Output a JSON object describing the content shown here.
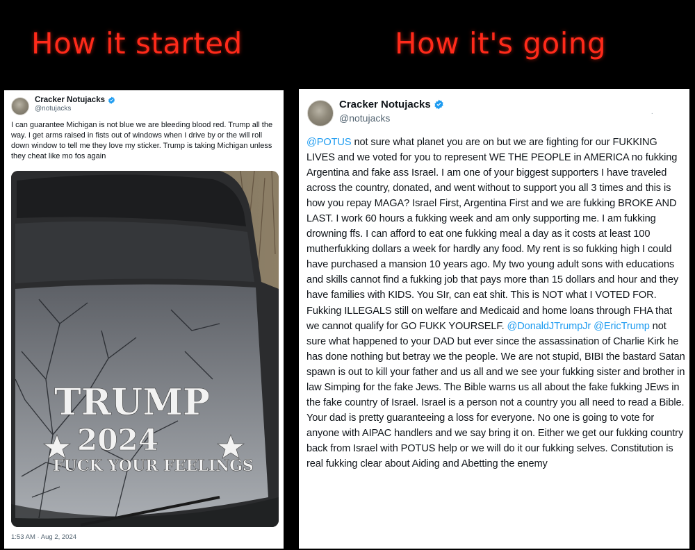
{
  "headings": {
    "left": "How it started",
    "right": "How it's going"
  },
  "colors": {
    "heading_red": "#ff2a1a",
    "mention_blue": "#1d9bf0",
    "verified_blue": "#1d9bf0",
    "background": "#000000"
  },
  "tweet_left": {
    "name": "Cracker Notujacks",
    "handle": "@notujacks",
    "text": "I can guarantee Michigan is not blue we are bleeding blood red. Trump all the way. I get arms raised in fists out of windows when I drive by or the will roll down window to tell me they love my sticker. Trump is taking Michigan unless they cheat like mo fos again",
    "photo": {
      "description_icon": "car-rear-window-photo",
      "sticker_line1": "TRUMP",
      "sticker_line2": "2024",
      "sticker_line3": "FUCK YOUR FEELINGS"
    },
    "timestamp": "1:53 AM · Aug 2, 2024"
  },
  "tweet_right": {
    "name": "Cracker Notujacks",
    "handle": "@notujacks",
    "dots": "·",
    "mention_potus": "@POTUS",
    "text_1": " not sure what planet you are on but we are fighting for our FUKKING LIVES and we voted for you to represent WE THE PEOPLE in AMERICA no fukking Argentina and fake ass Israel.  I am one of your biggest supporters I have traveled across the country, donated, and went without to support you all 3 times and this is how you repay MAGA? Israel First, Argentina First and we are fukking BROKE AND LAST. I work 60 hours a fukking week and am only supporting me. I am fukking drowning ffs. I can afford to eat one fukking meal a day as it costs at least 100 mutherfukking dollars  a week for hardly any food. My rent is so fukking high I could have purchased a mansion 10  years ago.  My two young adult sons with educations and skills cannot find a fukking job that pays more than 15 dollars and hour and they have families with KIDS. You SIr, can eat shit. This is NOT what I VOTED FOR. Fukking ILLEGALS still on welfare and Medicaid and home loans through FHA that we cannot qualify for GO FUKK YOURSELF.  ",
    "mention_djt": "@DonaldJTrumpJr",
    "mention_eric": "@EricTrump",
    "text_2": " not sure what happened to your DAD but ever since the assassination  of Charlie Kirk he has done nothing but betray we the people. We are not stupid, BIBI the bastard Satan spawn is out to kill your father and us all and we see your fukking sister and brother in law Simping for the fake Jews. The Bible warns us all about the fake fukking JEws in the fake country of Israel. Israel is a person not a country you all need to read a Bible. Your dad is pretty guaranteeing a loss for everyone. No one is going to vote for anyone with AIPAC handlers and we say bring it on. Either we get our fukking country back from Israel with POTUS help or we will do it our fukking selves. Constitution is real fukking clear about Aiding and Abetting the enemy"
  }
}
